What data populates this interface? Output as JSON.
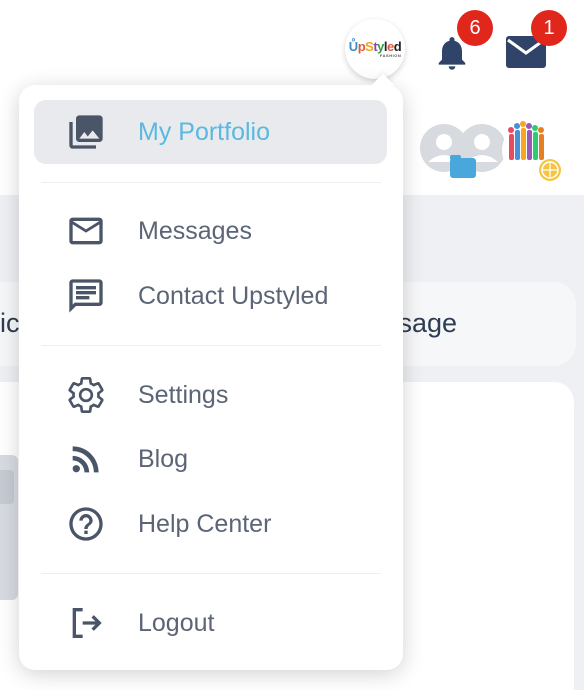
{
  "header": {
    "logo": {
      "text": "UpStyled",
      "subtext": "FASHION"
    },
    "notifications": {
      "icon": "bell-icon",
      "count": "6"
    },
    "messages": {
      "icon": "mail-icon",
      "count": "1"
    },
    "badge_color": "#e1261c"
  },
  "background": {
    "left_fragment": "ic",
    "right_fragment": "ssage"
  },
  "menu": {
    "items": [
      {
        "label": "My Portfolio",
        "icon": "photo-library-icon",
        "active": true
      },
      {
        "label": "Messages",
        "icon": "mail-outline-icon",
        "active": false
      },
      {
        "label": "Contact Upstyled",
        "icon": "chat-icon",
        "active": false
      },
      {
        "label": "Settings",
        "icon": "gear-icon",
        "active": false
      },
      {
        "label": "Blog",
        "icon": "rss-icon",
        "active": false
      },
      {
        "label": "Help Center",
        "icon": "help-circle-icon",
        "active": false
      },
      {
        "label": "Logout",
        "icon": "logout-icon",
        "active": false
      }
    ],
    "active_color": "#5bb8de",
    "text_color": "#5b6576"
  }
}
